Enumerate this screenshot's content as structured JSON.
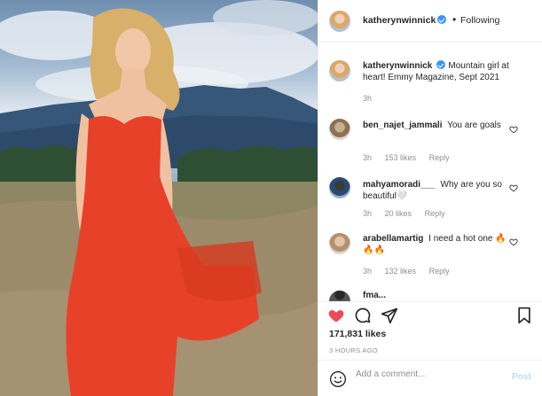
{
  "post": {
    "author": "katherynwinnick",
    "follow_label": "Following",
    "separator": "•",
    "caption_user": "katherynwinnick",
    "caption_text": "Mountain girl at heart! Emmy Magazine, Sept 2021",
    "caption_time": "3h",
    "likes": "171,831 likes",
    "time_ago": "3 HOURS AGO"
  },
  "comments": [
    {
      "user": "ben_najet_jammali",
      "text": "You are goals",
      "time": "3h",
      "likes": "153 likes",
      "reply": "Reply"
    },
    {
      "user": "mahyamoradi___",
      "text": "Why are you so beautiful🤍",
      "time": "3h",
      "likes": "20 likes",
      "reply": "Reply"
    },
    {
      "user": "arabellamartig",
      "text": "I need a hot one 🔥🔥🔥",
      "time": "3h",
      "likes": "132 likes",
      "reply": "Reply"
    }
  ],
  "partial_comment": {
    "user": "fma...",
    "text": ""
  },
  "composer": {
    "placeholder": "Add a comment...",
    "post_label": "Post"
  },
  "colors": {
    "liked_heart": "#ed4956",
    "verified": "#3897f0",
    "dress": "#e8412a",
    "post_disabled": "#b2dffc"
  },
  "icons": {
    "like": "heart-filled-icon",
    "comment": "comment-bubble-icon",
    "share": "paper-plane-icon",
    "save": "bookmark-icon",
    "emoji": "smiley-icon"
  }
}
